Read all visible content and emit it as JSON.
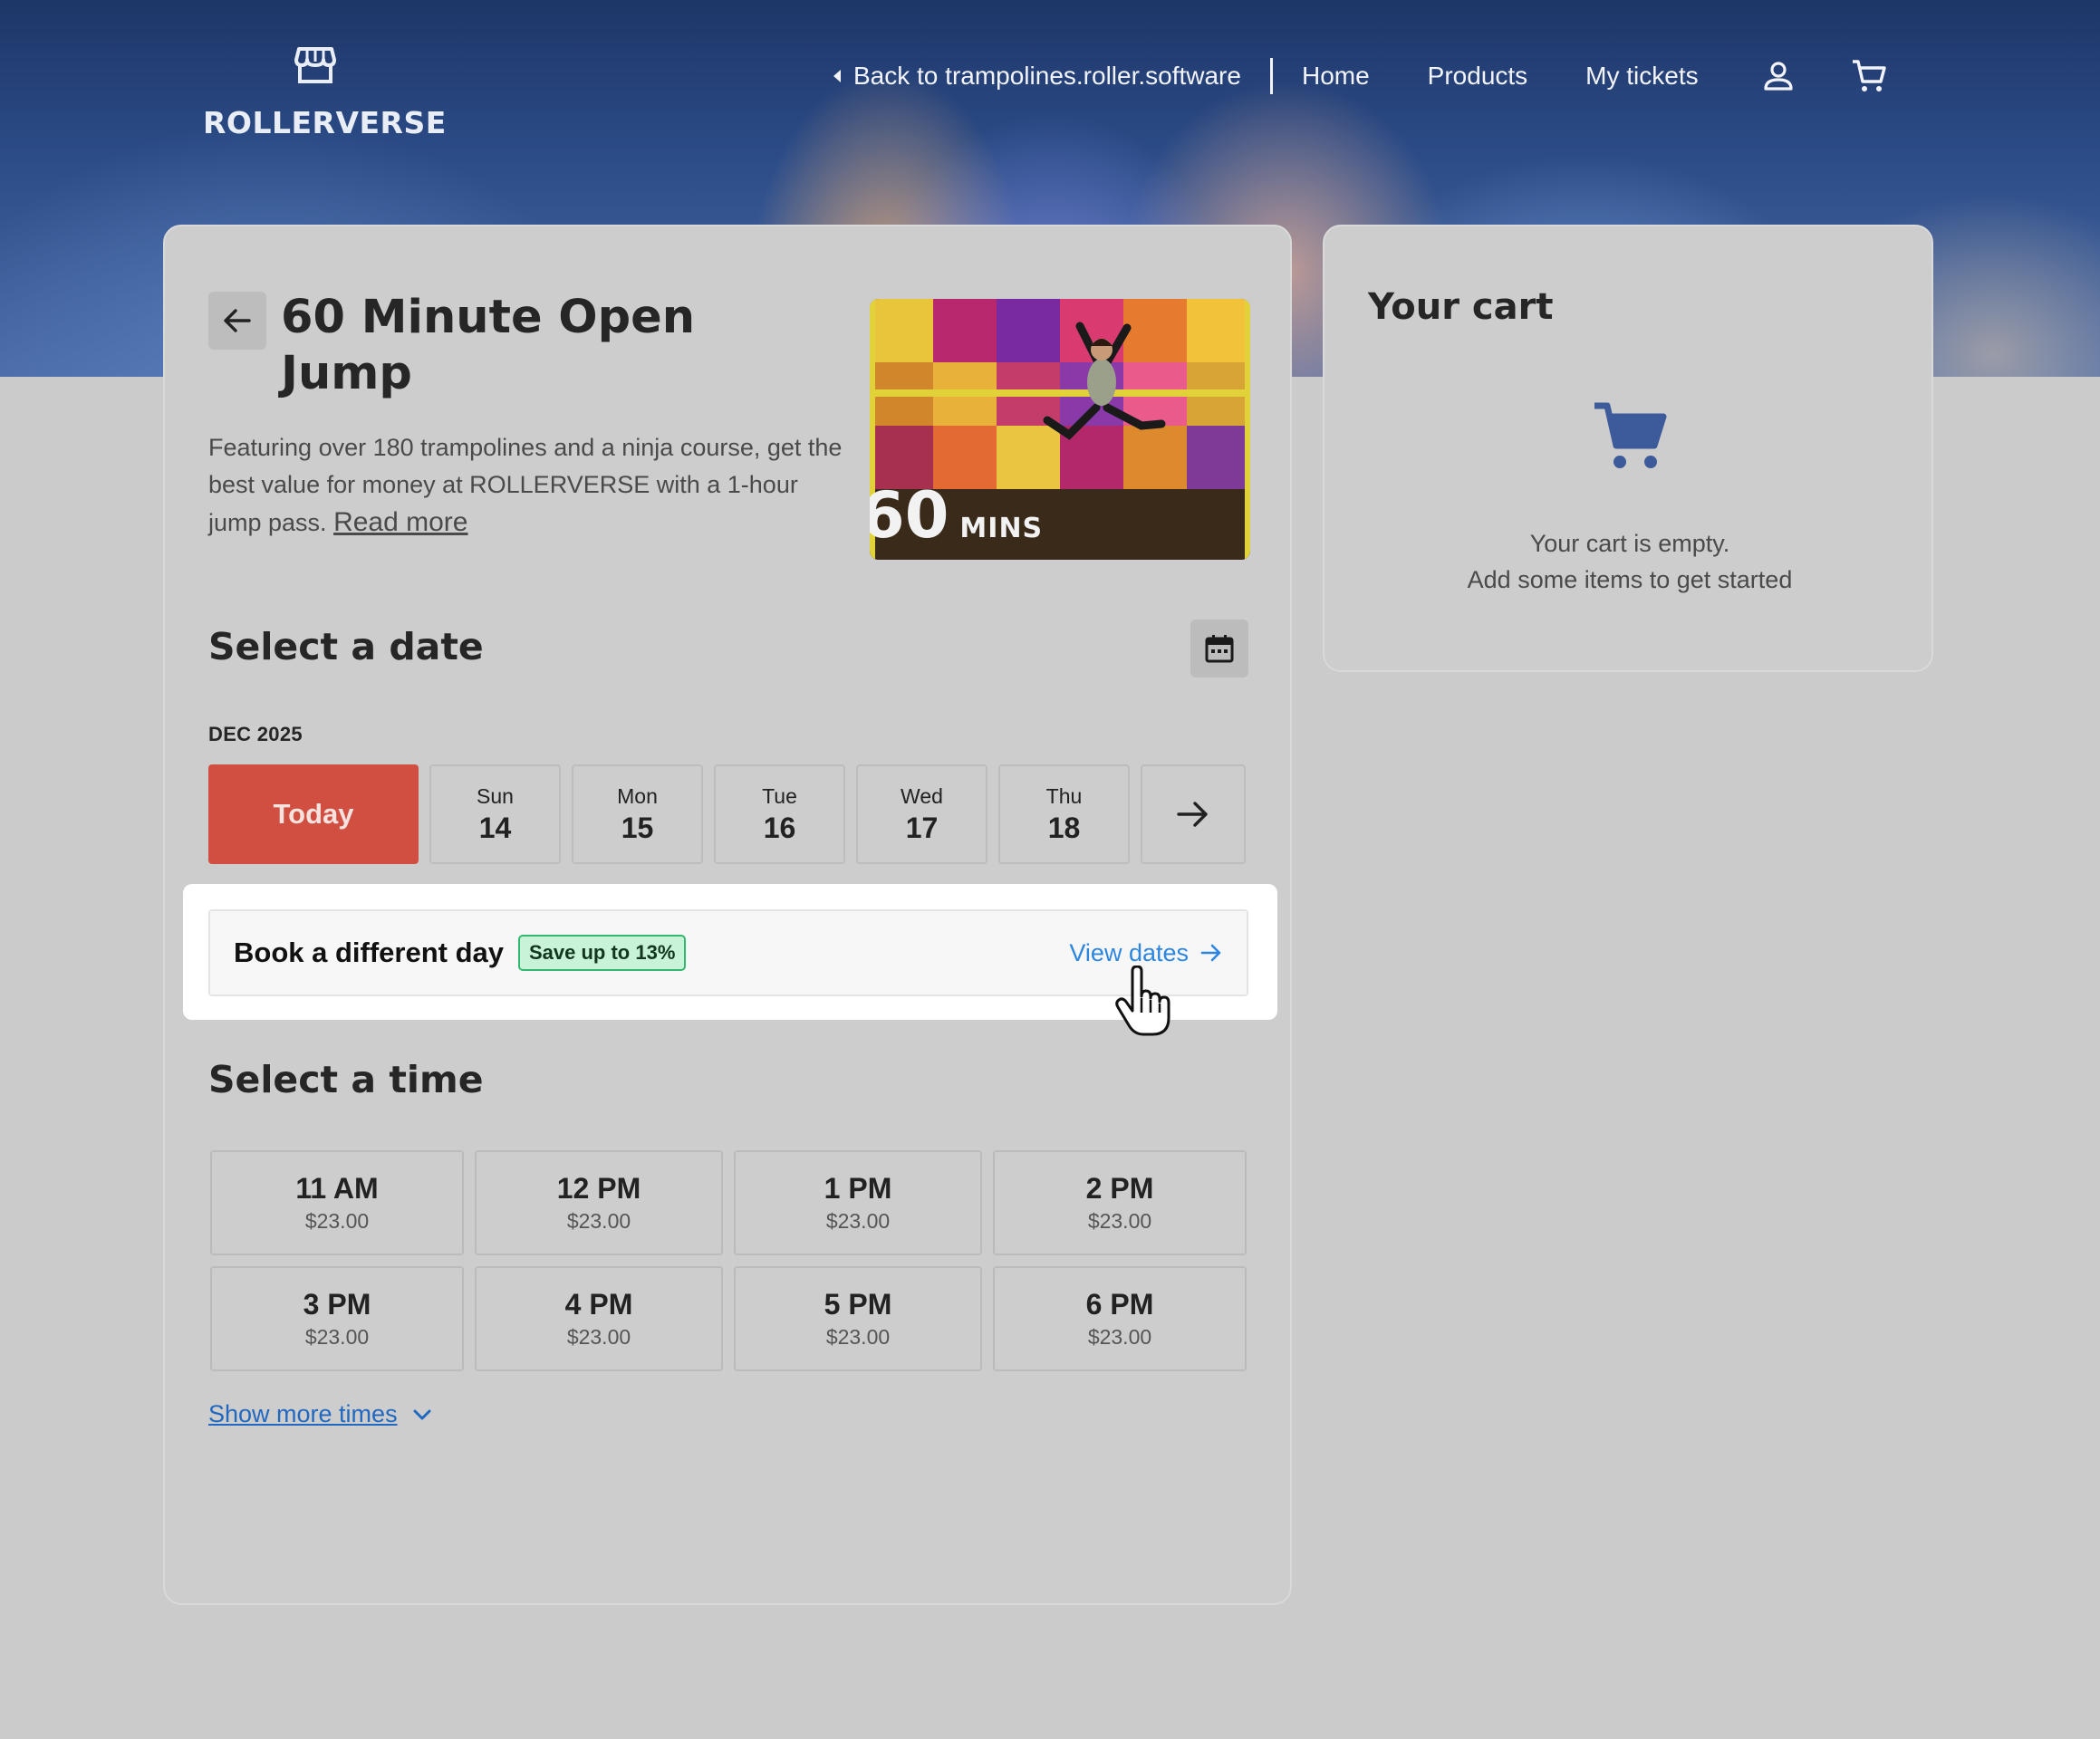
{
  "header": {
    "brand": "ROLLERVERSE",
    "back_link": "Back to trampolines.roller.software",
    "nav": [
      "Home",
      "Products",
      "My tickets"
    ],
    "icons": [
      "store-icon",
      "user-icon",
      "cart-icon"
    ]
  },
  "product": {
    "title": "60 Minute Open Jump",
    "description": "Featuring over 180 trampolines and a ninja course, get the best value for money at ROLLERVERSE with a 1-hour jump pass.",
    "read_more": "Read more",
    "image_badge_number": "60",
    "image_badge_unit": "MINS"
  },
  "date_section": {
    "title": "Select a date",
    "month": "DEC 2025",
    "today_label": "Today",
    "days": [
      {
        "dow": "Sun",
        "num": "14"
      },
      {
        "dow": "Mon",
        "num": "15"
      },
      {
        "dow": "Tue",
        "num": "16"
      },
      {
        "dow": "Wed",
        "num": "17"
      },
      {
        "dow": "Thu",
        "num": "18"
      }
    ]
  },
  "promo": {
    "title": "Book a different day",
    "badge": "Save up to 13%",
    "link": "View dates"
  },
  "time_section": {
    "title": "Select a time",
    "slots": [
      {
        "time": "11 AM",
        "price": "$23.00"
      },
      {
        "time": "12 PM",
        "price": "$23.00"
      },
      {
        "time": "1 PM",
        "price": "$23.00"
      },
      {
        "time": "2 PM",
        "price": "$23.00"
      },
      {
        "time": "3 PM",
        "price": "$23.00"
      },
      {
        "time": "4 PM",
        "price": "$23.00"
      },
      {
        "time": "5 PM",
        "price": "$23.00"
      },
      {
        "time": "6 PM",
        "price": "$23.00"
      }
    ],
    "show_more": "Show more times"
  },
  "cart": {
    "title": "Your cart",
    "empty_line1": "Your cart is empty.",
    "empty_line2": "Add some items to get started"
  },
  "colors": {
    "today": "#d14f40",
    "link": "#2c86e0",
    "badge_bg": "#c9f3d9",
    "badge_border": "#34b870",
    "cart_icon": "#3d5a9a"
  }
}
